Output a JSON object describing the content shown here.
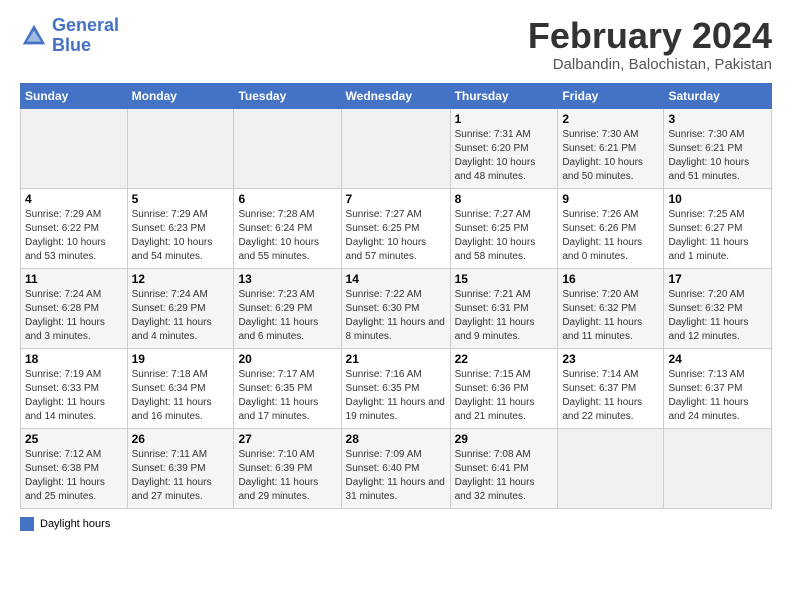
{
  "header": {
    "logo_line1": "General",
    "logo_line2": "Blue",
    "month_title": "February 2024",
    "location": "Dalbandin, Balochistan, Pakistan"
  },
  "days_of_week": [
    "Sunday",
    "Monday",
    "Tuesday",
    "Wednesday",
    "Thursday",
    "Friday",
    "Saturday"
  ],
  "legend": {
    "label": "Daylight hours"
  },
  "weeks": [
    [
      {
        "day": "",
        "sunrise": "",
        "sunset": "",
        "daylight": ""
      },
      {
        "day": "",
        "sunrise": "",
        "sunset": "",
        "daylight": ""
      },
      {
        "day": "",
        "sunrise": "",
        "sunset": "",
        "daylight": ""
      },
      {
        "day": "",
        "sunrise": "",
        "sunset": "",
        "daylight": ""
      },
      {
        "day": "1",
        "sunrise": "Sunrise: 7:31 AM",
        "sunset": "Sunset: 6:20 PM",
        "daylight": "Daylight: 10 hours and 48 minutes."
      },
      {
        "day": "2",
        "sunrise": "Sunrise: 7:30 AM",
        "sunset": "Sunset: 6:21 PM",
        "daylight": "Daylight: 10 hours and 50 minutes."
      },
      {
        "day": "3",
        "sunrise": "Sunrise: 7:30 AM",
        "sunset": "Sunset: 6:21 PM",
        "daylight": "Daylight: 10 hours and 51 minutes."
      }
    ],
    [
      {
        "day": "4",
        "sunrise": "Sunrise: 7:29 AM",
        "sunset": "Sunset: 6:22 PM",
        "daylight": "Daylight: 10 hours and 53 minutes."
      },
      {
        "day": "5",
        "sunrise": "Sunrise: 7:29 AM",
        "sunset": "Sunset: 6:23 PM",
        "daylight": "Daylight: 10 hours and 54 minutes."
      },
      {
        "day": "6",
        "sunrise": "Sunrise: 7:28 AM",
        "sunset": "Sunset: 6:24 PM",
        "daylight": "Daylight: 10 hours and 55 minutes."
      },
      {
        "day": "7",
        "sunrise": "Sunrise: 7:27 AM",
        "sunset": "Sunset: 6:25 PM",
        "daylight": "Daylight: 10 hours and 57 minutes."
      },
      {
        "day": "8",
        "sunrise": "Sunrise: 7:27 AM",
        "sunset": "Sunset: 6:25 PM",
        "daylight": "Daylight: 10 hours and 58 minutes."
      },
      {
        "day": "9",
        "sunrise": "Sunrise: 7:26 AM",
        "sunset": "Sunset: 6:26 PM",
        "daylight": "Daylight: 11 hours and 0 minutes."
      },
      {
        "day": "10",
        "sunrise": "Sunrise: 7:25 AM",
        "sunset": "Sunset: 6:27 PM",
        "daylight": "Daylight: 11 hours and 1 minute."
      }
    ],
    [
      {
        "day": "11",
        "sunrise": "Sunrise: 7:24 AM",
        "sunset": "Sunset: 6:28 PM",
        "daylight": "Daylight: 11 hours and 3 minutes."
      },
      {
        "day": "12",
        "sunrise": "Sunrise: 7:24 AM",
        "sunset": "Sunset: 6:29 PM",
        "daylight": "Daylight: 11 hours and 4 minutes."
      },
      {
        "day": "13",
        "sunrise": "Sunrise: 7:23 AM",
        "sunset": "Sunset: 6:29 PM",
        "daylight": "Daylight: 11 hours and 6 minutes."
      },
      {
        "day": "14",
        "sunrise": "Sunrise: 7:22 AM",
        "sunset": "Sunset: 6:30 PM",
        "daylight": "Daylight: 11 hours and 8 minutes."
      },
      {
        "day": "15",
        "sunrise": "Sunrise: 7:21 AM",
        "sunset": "Sunset: 6:31 PM",
        "daylight": "Daylight: 11 hours and 9 minutes."
      },
      {
        "day": "16",
        "sunrise": "Sunrise: 7:20 AM",
        "sunset": "Sunset: 6:32 PM",
        "daylight": "Daylight: 11 hours and 11 minutes."
      },
      {
        "day": "17",
        "sunrise": "Sunrise: 7:20 AM",
        "sunset": "Sunset: 6:32 PM",
        "daylight": "Daylight: 11 hours and 12 minutes."
      }
    ],
    [
      {
        "day": "18",
        "sunrise": "Sunrise: 7:19 AM",
        "sunset": "Sunset: 6:33 PM",
        "daylight": "Daylight: 11 hours and 14 minutes."
      },
      {
        "day": "19",
        "sunrise": "Sunrise: 7:18 AM",
        "sunset": "Sunset: 6:34 PM",
        "daylight": "Daylight: 11 hours and 16 minutes."
      },
      {
        "day": "20",
        "sunrise": "Sunrise: 7:17 AM",
        "sunset": "Sunset: 6:35 PM",
        "daylight": "Daylight: 11 hours and 17 minutes."
      },
      {
        "day": "21",
        "sunrise": "Sunrise: 7:16 AM",
        "sunset": "Sunset: 6:35 PM",
        "daylight": "Daylight: 11 hours and 19 minutes."
      },
      {
        "day": "22",
        "sunrise": "Sunrise: 7:15 AM",
        "sunset": "Sunset: 6:36 PM",
        "daylight": "Daylight: 11 hours and 21 minutes."
      },
      {
        "day": "23",
        "sunrise": "Sunrise: 7:14 AM",
        "sunset": "Sunset: 6:37 PM",
        "daylight": "Daylight: 11 hours and 22 minutes."
      },
      {
        "day": "24",
        "sunrise": "Sunrise: 7:13 AM",
        "sunset": "Sunset: 6:37 PM",
        "daylight": "Daylight: 11 hours and 24 minutes."
      }
    ],
    [
      {
        "day": "25",
        "sunrise": "Sunrise: 7:12 AM",
        "sunset": "Sunset: 6:38 PM",
        "daylight": "Daylight: 11 hours and 25 minutes."
      },
      {
        "day": "26",
        "sunrise": "Sunrise: 7:11 AM",
        "sunset": "Sunset: 6:39 PM",
        "daylight": "Daylight: 11 hours and 27 minutes."
      },
      {
        "day": "27",
        "sunrise": "Sunrise: 7:10 AM",
        "sunset": "Sunset: 6:39 PM",
        "daylight": "Daylight: 11 hours and 29 minutes."
      },
      {
        "day": "28",
        "sunrise": "Sunrise: 7:09 AM",
        "sunset": "Sunset: 6:40 PM",
        "daylight": "Daylight: 11 hours and 31 minutes."
      },
      {
        "day": "29",
        "sunrise": "Sunrise: 7:08 AM",
        "sunset": "Sunset: 6:41 PM",
        "daylight": "Daylight: 11 hours and 32 minutes."
      },
      {
        "day": "",
        "sunrise": "",
        "sunset": "",
        "daylight": ""
      },
      {
        "day": "",
        "sunrise": "",
        "sunset": "",
        "daylight": ""
      }
    ]
  ]
}
